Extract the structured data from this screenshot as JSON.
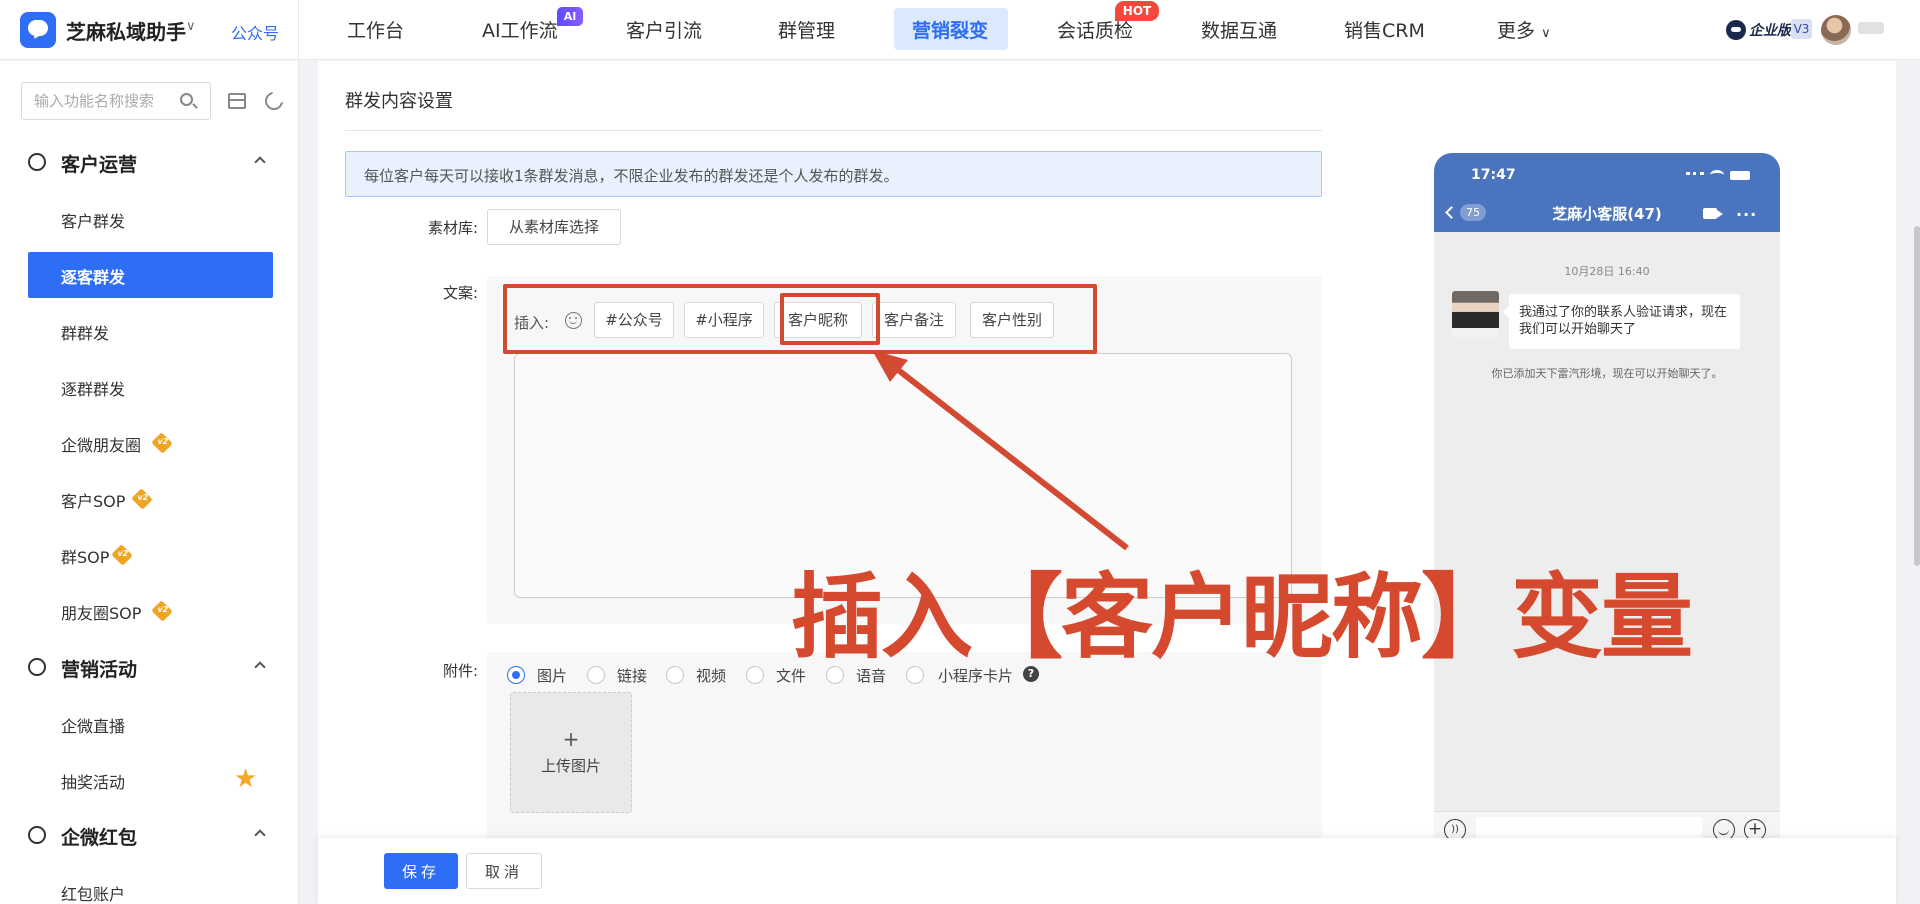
{
  "app": {
    "name": "芝麻私域助手",
    "account_type": "公众号"
  },
  "nav": {
    "items": [
      "工作台",
      "AI工作流",
      "客户引流",
      "群管理",
      "营销裂变",
      "会话质检",
      "数据互通",
      "销售CRM",
      "更多"
    ],
    "active": "营销裂变",
    "badge_ai": "AI",
    "badge_hot": "HOT",
    "more_caret": "∨"
  },
  "user": {
    "edition": "企业版",
    "version": "V3"
  },
  "sidebar": {
    "search_placeholder": "输入功能名称搜索",
    "groups": [
      {
        "title": "客户运营",
        "items": [
          "客户群发",
          "逐客群发",
          "群群发",
          "逐群群发",
          "企微朋友圈",
          "客户SOP",
          "群SOP",
          "朋友圈SOP"
        ]
      },
      {
        "title": "营销活动",
        "items": [
          "企微直播",
          "抽奖活动"
        ]
      },
      {
        "title": "企微红包",
        "items": [
          "红包账户"
        ]
      }
    ],
    "v2_badge": "v2",
    "active_item": "逐客群发"
  },
  "form": {
    "section_title": "群发内容设置",
    "notice": "每位客户每天可以接收1条群发消息，不限企业发布的群发还是个人发布的群发。",
    "material_label": "素材库:",
    "material_button": "从素材库选择",
    "copy_label": "文案:",
    "insert_label": "插入:",
    "insert_tags": [
      "#公众号",
      "#小程序",
      "客户昵称",
      "客户备注",
      "客户性别"
    ],
    "attach_label": "附件:",
    "attach_types": [
      "图片",
      "链接",
      "视频",
      "文件",
      "语音",
      "小程序卡片"
    ],
    "attach_selected": "图片",
    "upload_plus": "+",
    "upload_label": "上传图片"
  },
  "phone": {
    "time": "17:47",
    "back_count": "75",
    "chat_title": "芝麻小客服(47)",
    "more": "···",
    "date": "10月28日 16:40",
    "message": "我通过了你的联系人验证请求，现在我们可以开始聊天了",
    "system_message": "你已添加天下雷汽形境，现在可以开始聊天了。"
  },
  "annotation": {
    "text": "插入【客户昵称】变量",
    "color": "#d34a32"
  },
  "footer": {
    "save": "保存",
    "cancel": "取消"
  }
}
